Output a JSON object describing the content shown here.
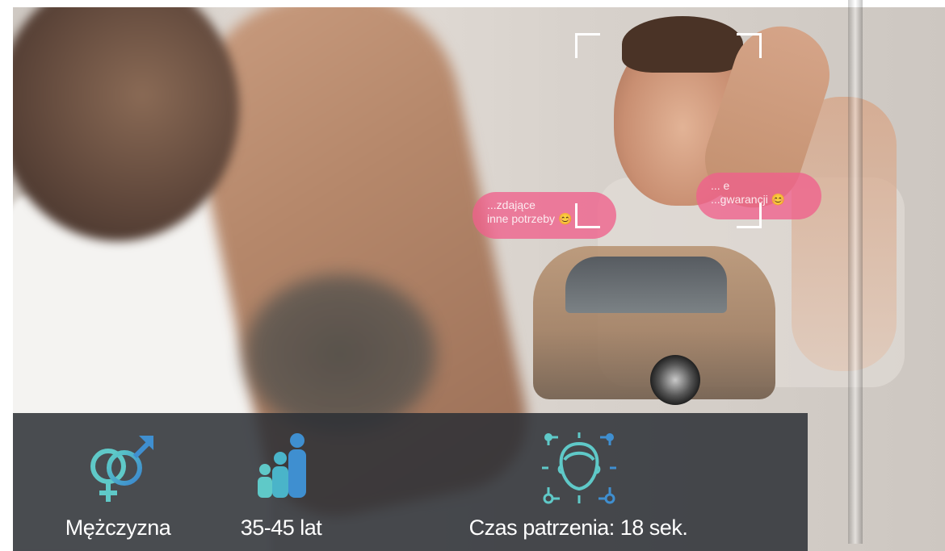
{
  "scene": {
    "bubble_left_text": "...zdające\ninne potrzeby 😊",
    "bubble_right_text": "... e\n...gwarancji 😊"
  },
  "info_bar": {
    "gender": {
      "icon": "gender-icon",
      "label": "Mężczyzna"
    },
    "age": {
      "icon": "age-group-icon",
      "label": "35-45 lat"
    },
    "gaze": {
      "icon": "face-scan-icon",
      "label": "Czas patrzenia: 18 sek."
    }
  },
  "colors": {
    "accent_teal": "#5fc9c8",
    "accent_blue": "#3f8fd0",
    "bar_background": "#2c3036",
    "bubble_pink": "#f0608c"
  }
}
